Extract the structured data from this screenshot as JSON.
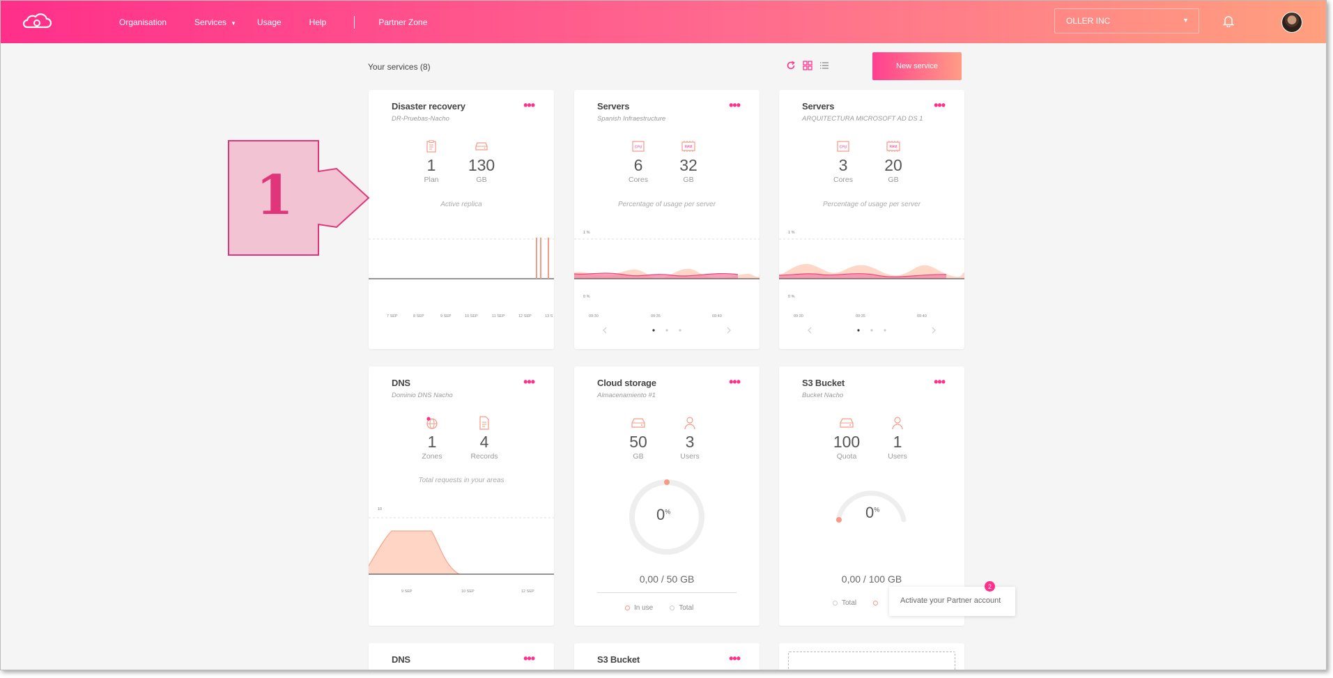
{
  "nav": {
    "items": [
      "Organisation",
      "Services",
      "Usage",
      "Help",
      "Partner Zone"
    ],
    "org": "OLLER INC"
  },
  "header": {
    "title": "Your services (8)",
    "new_service": "New service"
  },
  "icons": {
    "logo": "cloud-logo",
    "refresh": "refresh-icon",
    "grid": "grid-view-icon",
    "list": "list-view-icon",
    "bell": "bell-icon"
  },
  "colors": {
    "accent": "#ff2f8a",
    "accent2": "#ff9c85"
  },
  "cards": [
    {
      "title": "Disaster recovery",
      "subtitle": "DR-Pruebas-Nacho",
      "s1v": "1",
      "s1l": "Plan",
      "s2v": "130",
      "s2l": "GB",
      "caption": "Active replica",
      "xticks": [
        "7 SEP",
        "8 SEP",
        "9 SEP",
        "10 SEP",
        "11 SEP",
        "12 SEP",
        "13 S"
      ]
    },
    {
      "title": "Servers",
      "subtitle": "Spanish Infraestructure",
      "s1v": "6",
      "s1l": "Cores",
      "s2v": "32",
      "s2l": "GB",
      "caption": "Percentage of usage per server",
      "ytop": "1 %",
      "ybot": "0 %",
      "xticks": [
        "09:30",
        "09:35",
        "09:40"
      ]
    },
    {
      "title": "Servers",
      "subtitle": "ARQUITECTURA MICROSOFT AD DS 1",
      "s1v": "3",
      "s1l": "Cores",
      "s2v": "20",
      "s2l": "GB",
      "caption": "Percentage of usage per server",
      "ytop": "1 %",
      "ybot": "0 %",
      "xticks": [
        "09:30",
        "09:35",
        "09:40"
      ]
    },
    {
      "title": "DNS",
      "subtitle": "Dominio DNS Nacho",
      "s1v": "1",
      "s1l": "Zones",
      "s2v": "4",
      "s2l": "Records",
      "caption": "Total requests in your areas",
      "ytop": "10",
      "ybot": "0",
      "xticks": [
        "9 SEP",
        "10 SEP",
        "12 SEP"
      ]
    },
    {
      "title": "Cloud storage",
      "subtitle": "Almacenamiento #1",
      "s1v": "50",
      "s1l": "GB",
      "s2v": "3",
      "s2l": "Users",
      "gauge": "0",
      "usage": "0,00 / 50 GB",
      "leg1": "In use",
      "leg2": "Total"
    },
    {
      "title": "S3 Bucket",
      "subtitle": "Bucket Nacho",
      "s1v": "100",
      "s1l": "Quota",
      "s2v": "1",
      "s2l": "Users",
      "gauge": "0",
      "usage": "0,00 / 100 GB",
      "leg1": "Total"
    },
    {
      "title": "DNS"
    },
    {
      "title": "S3 Bucket"
    }
  ],
  "toast": {
    "text": "Activate your Partner account",
    "count": "2"
  },
  "callout": {
    "number": "1"
  }
}
